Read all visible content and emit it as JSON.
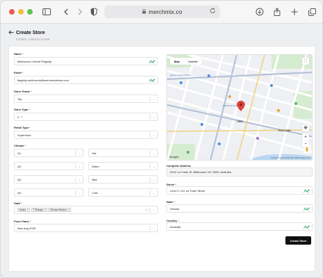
{
  "browser": {
    "url": "merchmix.co"
  },
  "header": {
    "title": "Create Store",
    "breadcrumb": "STORES  /  CREATE STORE"
  },
  "form": {
    "name": {
      "label": "Name",
      "value": "Melbourne Central Flagship"
    },
    "email": {
      "label": "Email",
      "value": "flagship.melbourne@merchmixdemo.com"
    },
    "store_grade": {
      "label": "Store Grade",
      "value": "Top"
    },
    "store_type": {
      "label": "Store Type",
      "value": "C"
    },
    "retail_type": {
      "label": "Retail Type",
      "value": "Superstore"
    },
    "climate": {
      "label": "Climate",
      "rows": [
        {
          "quarter": "Q1",
          "value": "Hot"
        },
        {
          "quarter": "Q2",
          "value": "Warm"
        },
        {
          "quarter": "Q3",
          "value": "Mild"
        },
        {
          "quarter": "Q4",
          "value": "Cold"
        }
      ]
    },
    "staff": {
      "label": "Staff",
      "chips": [
        "James",
        "T Strange",
        "Gemma Hewson"
      ]
    },
    "floor_plans": {
      "label": "Floor Plans",
      "value": "New Aug 2025"
    },
    "complete_address": {
      "label": "Complete Address",
      "value": "2/211 La Trobe St, Melbourne VIC 3000, Australia"
    },
    "street": {
      "label": "Street",
      "value": "Level 2, 211 La Trobe Street"
    },
    "state": {
      "label": "State",
      "value": "Victoria"
    },
    "country": {
      "label": "Country",
      "value": "Australia"
    },
    "required_mark": "*"
  },
  "map": {
    "tabs": [
      "Map",
      "Satellite"
    ],
    "footer": "Keyboard shortcuts   Map data ©2025 Google   Terms",
    "google": "Google",
    "labels": [
      "CBD",
      "EAST END",
      "Melbourne Central",
      "Queen Victoria Market"
    ]
  },
  "actions": {
    "create_label": "Create Store"
  },
  "colors": {
    "primary": "#111111",
    "accent_icon": "#2e9e5b",
    "pin": "#e0463c"
  }
}
